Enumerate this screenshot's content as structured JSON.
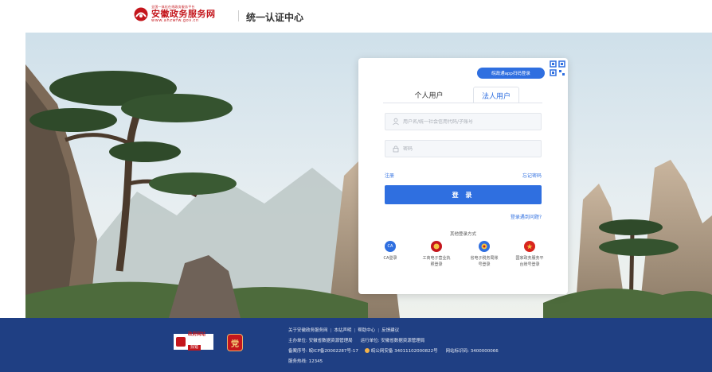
{
  "header": {
    "logo_small": "全国一体化在线政务服务平台",
    "logo_main": "安徽政务服务网",
    "logo_url": "www.ahzwfw.gov.cn",
    "title": "统一认证中心"
  },
  "login": {
    "app_login_label": "皖政通app扫码登录",
    "tabs": [
      {
        "label": "个人用户",
        "active": false
      },
      {
        "label": "法人用户",
        "active": true
      }
    ],
    "username_placeholder": "用户名/统一社会信用代码/子账号",
    "password_placeholder": "密码",
    "register_label": "注册",
    "forgot_label": "忘记密码",
    "submit_label": "登 录",
    "problem_label": "登录遇到问题?",
    "other_title": "其他登录方式",
    "other_methods": [
      {
        "label": "CA登录",
        "icon": "ca-icon",
        "icon_text": "CA",
        "color": "#2f6fe0"
      },
      {
        "label": "工商电子营业执照登录",
        "icon": "business-license-icon",
        "color": "#c4161c"
      },
      {
        "label": "省电子税务局账号登录",
        "icon": "tax-bureau-icon",
        "color": "#2f6fe0"
      },
      {
        "label": "国家政务服务平台账号登录",
        "icon": "national-emblem-icon",
        "color": "#d8251d"
      }
    ]
  },
  "footer": {
    "badge1_top": "政府网站",
    "badge1_bottom": "找错",
    "badge2_glyph": "党",
    "links": [
      "关于安徽政务服务网",
      "本站声明",
      "帮助中心",
      "反馈建议"
    ],
    "sponsor": "主办单位: 安徽省数据资源管理局",
    "operator": "运行单位: 安徽省数据资源管理局",
    "icp": "备案序号: 皖ICP备20002287号-17",
    "police": "皖公网安备 34011102000822号",
    "site_code": "网站标识码: 3400000066",
    "hotline": "服务热线: 12345"
  },
  "colors": {
    "accent": "#2f6fe0",
    "footer_bg": "#1f3f83",
    "brand_red": "#c4161c"
  }
}
